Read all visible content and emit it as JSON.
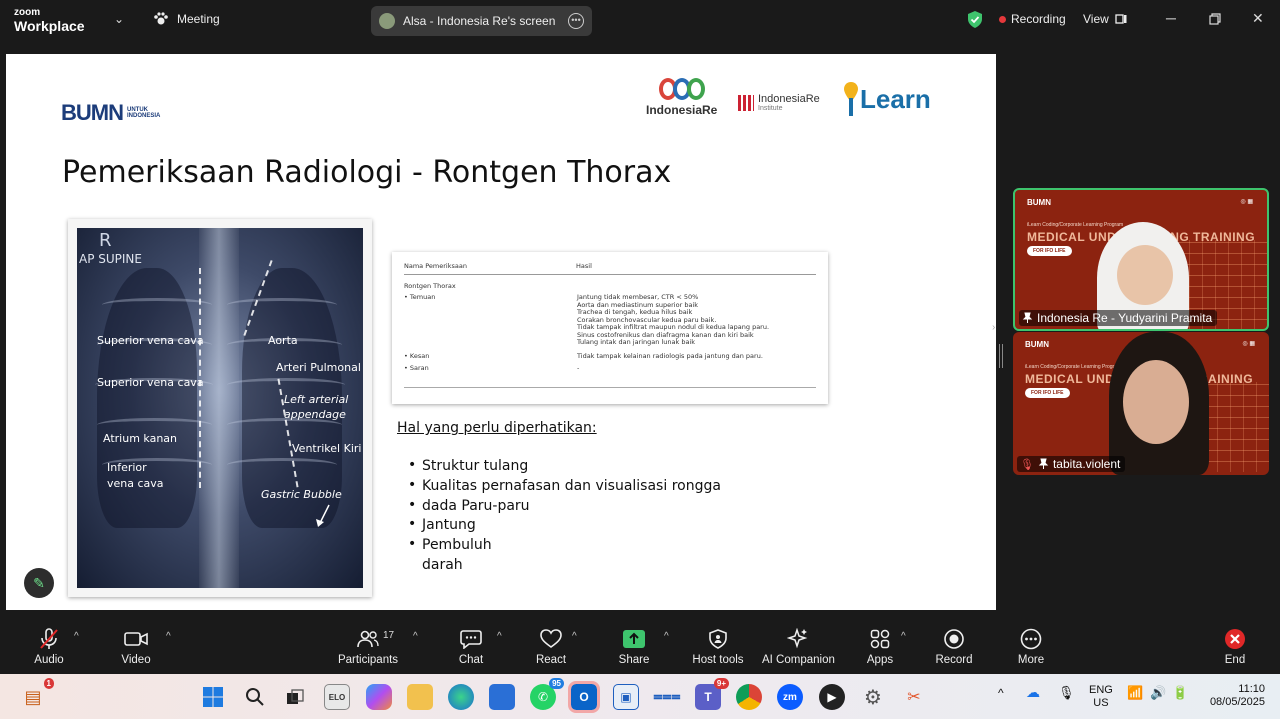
{
  "topbar": {
    "app_small": "zoom",
    "app_big": "Workplace",
    "meeting_label": "Meeting",
    "share_title": "Alsa - Indonesia Re's screen",
    "recording_label": "Recording",
    "view_label": "View"
  },
  "slide": {
    "bumn_big": "BUMN",
    "bumn_small_1": "UNTUK",
    "bumn_small_2": "INDONESIA",
    "logo_ire": "IndonesiaRe",
    "logo_iri": "IndonesiaRe",
    "logo_iri_sub": "Institute",
    "logo_learn": "Learn",
    "title": "Pemeriksaan Radiologi - Rontgen Thorax",
    "xray": {
      "marker": "R",
      "position": "AP SUPINE",
      "labels": {
        "svc1": "Superior vena cava",
        "svc2": "Superior vena cava",
        "atrium": "Atrium kanan",
        "ivc1": "Inferior",
        "ivc2": "vena cava",
        "aorta": "Aorta",
        "arteri": "Arteri Pulmonal",
        "laa1": "Left arterial",
        "laa2": "appendage",
        "ventrikel": "Ventrikel Kiri",
        "gastric": "Gastric Bubble"
      }
    },
    "report": {
      "col1": "Nama Pemeriksaan",
      "col2": "Hasil",
      "section": "Rontgen Thorax",
      "temuan": "• Temuan",
      "kesan": "• Kesan",
      "saran": "• Saran",
      "temuan_lines": [
        "Jantung tidak membesar, CTR < 50%",
        "Aorta dan mediastinum superior baik",
        "Trachea di tengah, kedua hilus baik",
        "Corakan bronchovascular kedua paru baik.",
        "Tidak tampak infiltrat maupun nodul di kedua lapang paru.",
        "Sinus costofrenikus dan diafragma kanan dan kiri baik",
        "Tulang intak dan jaringan lunak baik"
      ],
      "kesan_text": "Tidak tampak kelainan radiologis pada jantung dan paru.",
      "saran_text": "-"
    },
    "hal_title": "Hal yang perlu diperhatikan:",
    "bullets": [
      {
        "text": "Struktur tulang",
        "bullet": true
      },
      {
        "text": "Kualitas pernafasan dan visualisasi rongga",
        "bullet": true
      },
      {
        "text": "dada Paru-paru",
        "bullet": true
      },
      {
        "text": "Jantung",
        "bullet": true
      },
      {
        "text": "Pembuluh",
        "bullet": true
      },
      {
        "text": "darah",
        "bullet": false
      }
    ]
  },
  "tiles": [
    {
      "logo": "BUMN",
      "sub": "iLearn Coding/Corporate Learning Program",
      "title": "MEDICAL UNDERWRITING TRAINING",
      "badge": "FOR IFO LIFE",
      "name": "Indonesia Re - Yudyarini Pramita"
    },
    {
      "logo": "BUMN",
      "sub": "iLearn Coding/Corporate Learning Program",
      "title": "MEDICAL UNDERWRITING TRAINING",
      "badge": "FOR IFO LIFE",
      "name": "tabita.violent"
    }
  ],
  "toolbar": {
    "audio": "Audio",
    "video": "Video",
    "participants": "Participants",
    "participants_count": "17",
    "chat": "Chat",
    "react": "React",
    "share": "Share",
    "host_tools": "Host tools",
    "ai_companion": "AI Companion",
    "apps": "Apps",
    "record": "Record",
    "more": "More",
    "end": "End"
  },
  "taskbar": {
    "widget_badge": "1",
    "whatsapp_badge": "95",
    "teams_badge": "9+",
    "lang_1": "ENG",
    "lang_2": "US",
    "time": "11:10",
    "date": "08/05/2025",
    "elo_label": "ELO",
    "zoom_label": "zm"
  },
  "colors": {
    "accent_green": "#3ec46d",
    "tile_bg": "#8c2310",
    "record_red": "#e5383b",
    "end_red": "#e02828"
  }
}
